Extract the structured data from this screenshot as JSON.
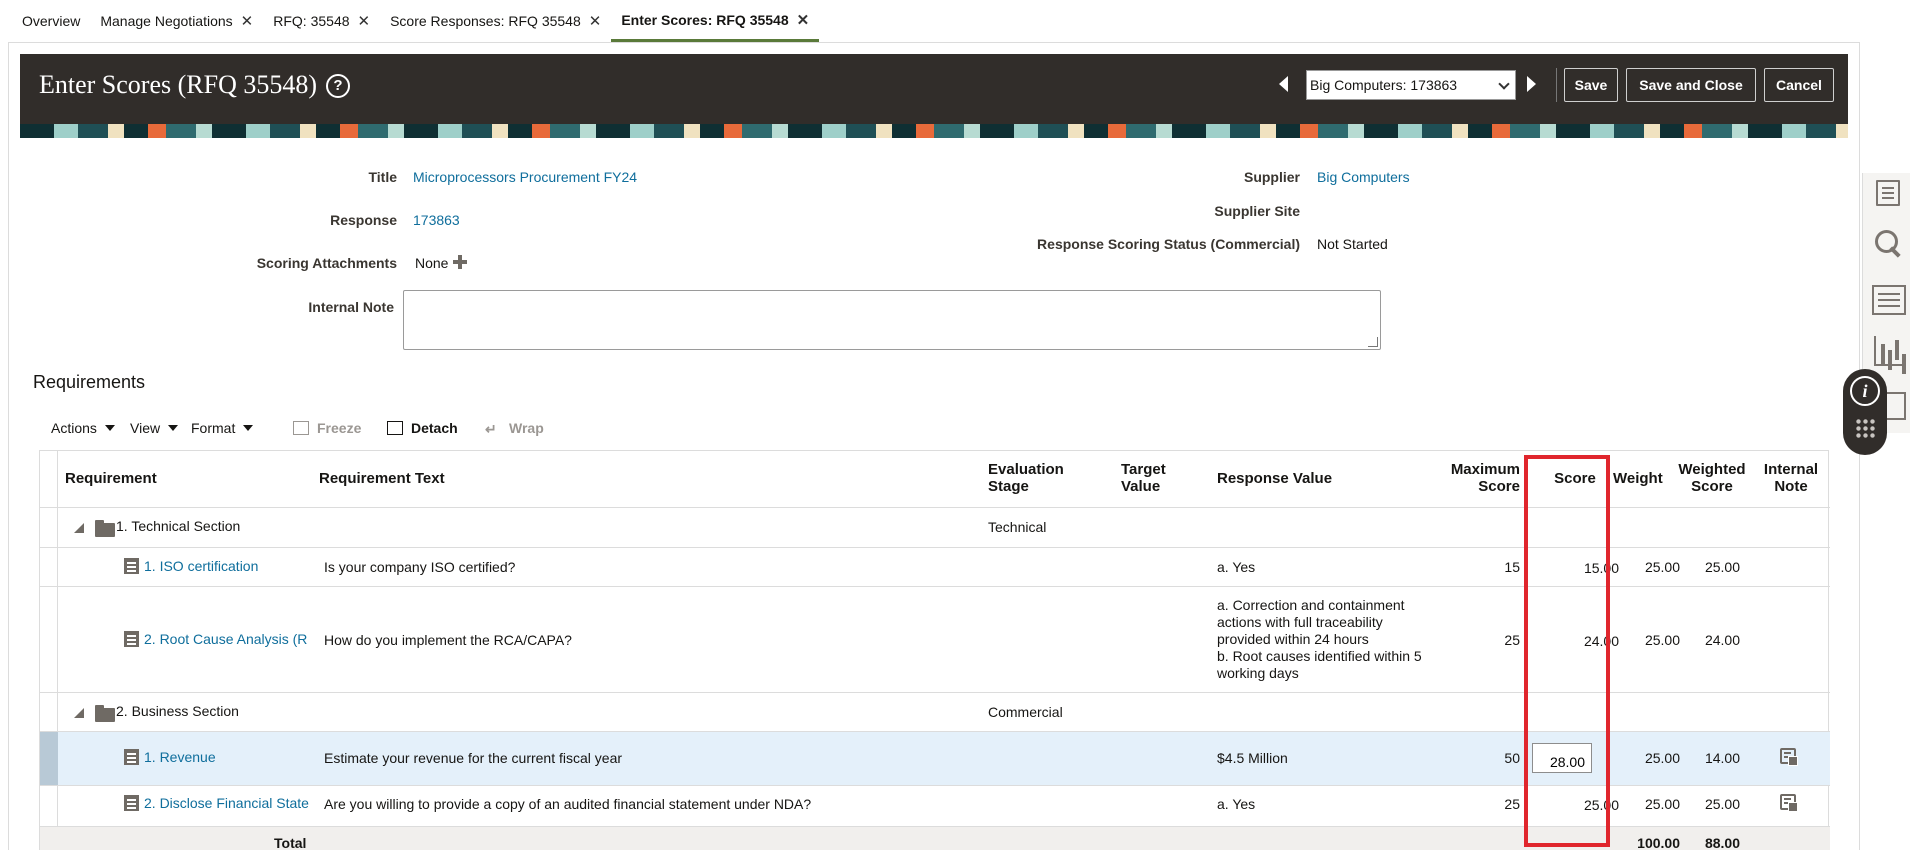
{
  "tabs": [
    {
      "label": "Overview",
      "closable": false,
      "active": false
    },
    {
      "label": "Manage Negotiations",
      "closable": true,
      "active": false
    },
    {
      "label": "RFQ: 35548",
      "closable": true,
      "active": false
    },
    {
      "label": "Score Responses: RFQ 35548",
      "closable": true,
      "active": false
    },
    {
      "label": "Enter Scores: RFQ 35548",
      "closable": true,
      "active": true
    }
  ],
  "header": {
    "title": "Enter Scores (RFQ 35548)",
    "help_glyph": "?",
    "supplier_select": "Big Computers: 173863",
    "save_label": "Save",
    "save_close_label": "Save and Close",
    "cancel_label": "Cancel"
  },
  "form": {
    "title_label": "Title",
    "title_value": "Microprocessors Procurement FY24",
    "response_label": "Response",
    "response_value": "173863",
    "attachments_label": "Scoring Attachments",
    "attachments_value": "None",
    "internal_note_label": "Internal Note",
    "supplier_label": "Supplier",
    "supplier_value": "Big Computers",
    "supplier_site_label": "Supplier Site",
    "scoring_status_label": "Response Scoring Status (Commercial)",
    "scoring_status_value": "Not Started"
  },
  "requirements": {
    "section_title": "Requirements",
    "toolbar": {
      "actions": "Actions",
      "view": "View",
      "format": "Format",
      "freeze": "Freeze",
      "detach": "Detach",
      "wrap": "Wrap"
    },
    "columns": {
      "requirement": "Requirement",
      "requirement_text": "Requirement Text",
      "evaluation_stage_1": "Evaluation",
      "evaluation_stage_2": "Stage",
      "target_value_1": "Target",
      "target_value_2": "Value",
      "response_value": "Response Value",
      "max_score_1": "Maximum",
      "max_score_2": "Score",
      "score": "Score",
      "weight": "Weight",
      "weighted_score_1": "Weighted",
      "weighted_score_2": "Score",
      "internal_note_1": "Internal",
      "internal_note_2": "Note"
    },
    "sections": [
      {
        "name": "1. Technical Section",
        "stage": "Technical"
      },
      {
        "name": "2. Business Section",
        "stage": "Commercial"
      }
    ],
    "rows": [
      {
        "name": "1. ISO certification",
        "text": "Is your company ISO certified?",
        "response": "a. Yes",
        "max": "15",
        "score": "15.00",
        "weight": "25.00",
        "weighted": "25.00"
      },
      {
        "name": "2. Root Cause Analysis (R",
        "text": "How do you implement the RCA/CAPA?",
        "response_lines": [
          "a. Correction and containment",
          "actions with full traceability",
          "provided within 24 hours",
          "b. Root causes identified within 5",
          "working days"
        ],
        "max": "25",
        "score": "24.00",
        "weight": "25.00",
        "weighted": "24.00"
      },
      {
        "name": "1. Revenue",
        "text": "Estimate your revenue for the current fiscal year",
        "response": "$4.5 Million",
        "max": "50",
        "score": "28.00",
        "weight": "25.00",
        "weighted": "14.00"
      },
      {
        "name": "2. Disclose Financial State",
        "text": "Are you willing to provide a copy of an audited financial statement under NDA?",
        "response": "a. Yes",
        "max": "25",
        "score": "25.00",
        "weight": "25.00",
        "weighted": "25.00"
      }
    ],
    "total": {
      "label": "Total",
      "weight": "100.00",
      "weighted": "88.00"
    }
  },
  "colors": {
    "header_bg": "#312d2a",
    "link": "#0f6e9c",
    "selected_row": "#e4f0fa",
    "highlight_box": "#e0262d",
    "active_tab_underline": "#5a7a3a"
  },
  "icons": [
    "help-icon",
    "prev-arrow-icon",
    "next-arrow-icon",
    "add-icon",
    "expand-icon",
    "folder-icon",
    "document-icon",
    "note-icon",
    "info-icon",
    "freeze-icon",
    "detach-icon",
    "wrap-icon"
  ]
}
